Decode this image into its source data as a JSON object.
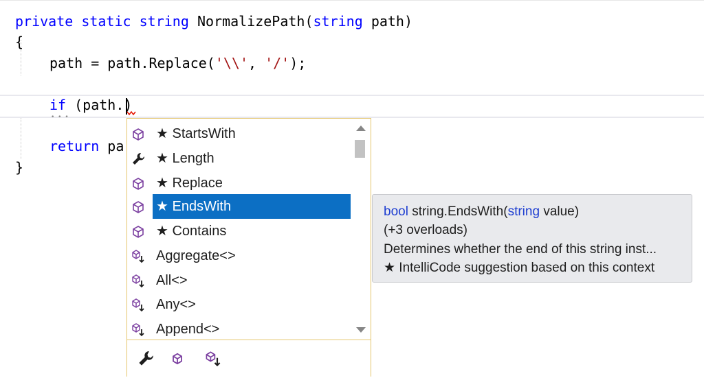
{
  "code": {
    "line1": {
      "kw_private": "private",
      "kw_static": "static",
      "kw_string": "string",
      "method": "NormalizePath(",
      "kw_param_type": "string",
      "param": "path)"
    },
    "line2": "{",
    "line3": {
      "pre": "path = path.Replace(",
      "str1": "'\\\\'",
      "comma": ", ",
      "str2": "'/'",
      "post": ");"
    },
    "line5": {
      "kw_if": "if",
      "rest": "(path.",
      "close": ")"
    },
    "line7": {
      "kw_return": "return",
      "rest": "pa"
    },
    "line8": "}"
  },
  "completion": {
    "items": [
      {
        "label": "★ StartsWith",
        "icon": "method-icon"
      },
      {
        "label": "★ Length",
        "icon": "property-wrench-icon"
      },
      {
        "label": "★ Replace",
        "icon": "method-icon"
      },
      {
        "label": "★ EndsWith",
        "icon": "method-icon",
        "selected": true
      },
      {
        "label": "★ Contains",
        "icon": "method-icon"
      },
      {
        "label": "Aggregate<>",
        "icon": "extension-method-icon"
      },
      {
        "label": "All<>",
        "icon": "extension-method-icon"
      },
      {
        "label": "Any<>",
        "icon": "extension-method-icon"
      },
      {
        "label": "Append<>",
        "icon": "extension-method-icon"
      }
    ],
    "filters": [
      "property-filter-icon",
      "method-filter-icon",
      "extension-method-filter-icon"
    ]
  },
  "tooltip": {
    "sig_kw": "bool",
    "sig_mid": " string.EndsWith(",
    "sig_param_kw": "string",
    "sig_end": " value)",
    "overloads": "(+3 overloads)",
    "description": "Determines whether the end of this string inst...",
    "intellicode": "★ IntelliCode suggestion based on this context"
  },
  "colors": {
    "keyword": "#0000ff",
    "string": "#a31515",
    "selection": "#0c6fc4",
    "popup_border": "#e4c56b",
    "icon_purple": "#7b3fa0"
  }
}
